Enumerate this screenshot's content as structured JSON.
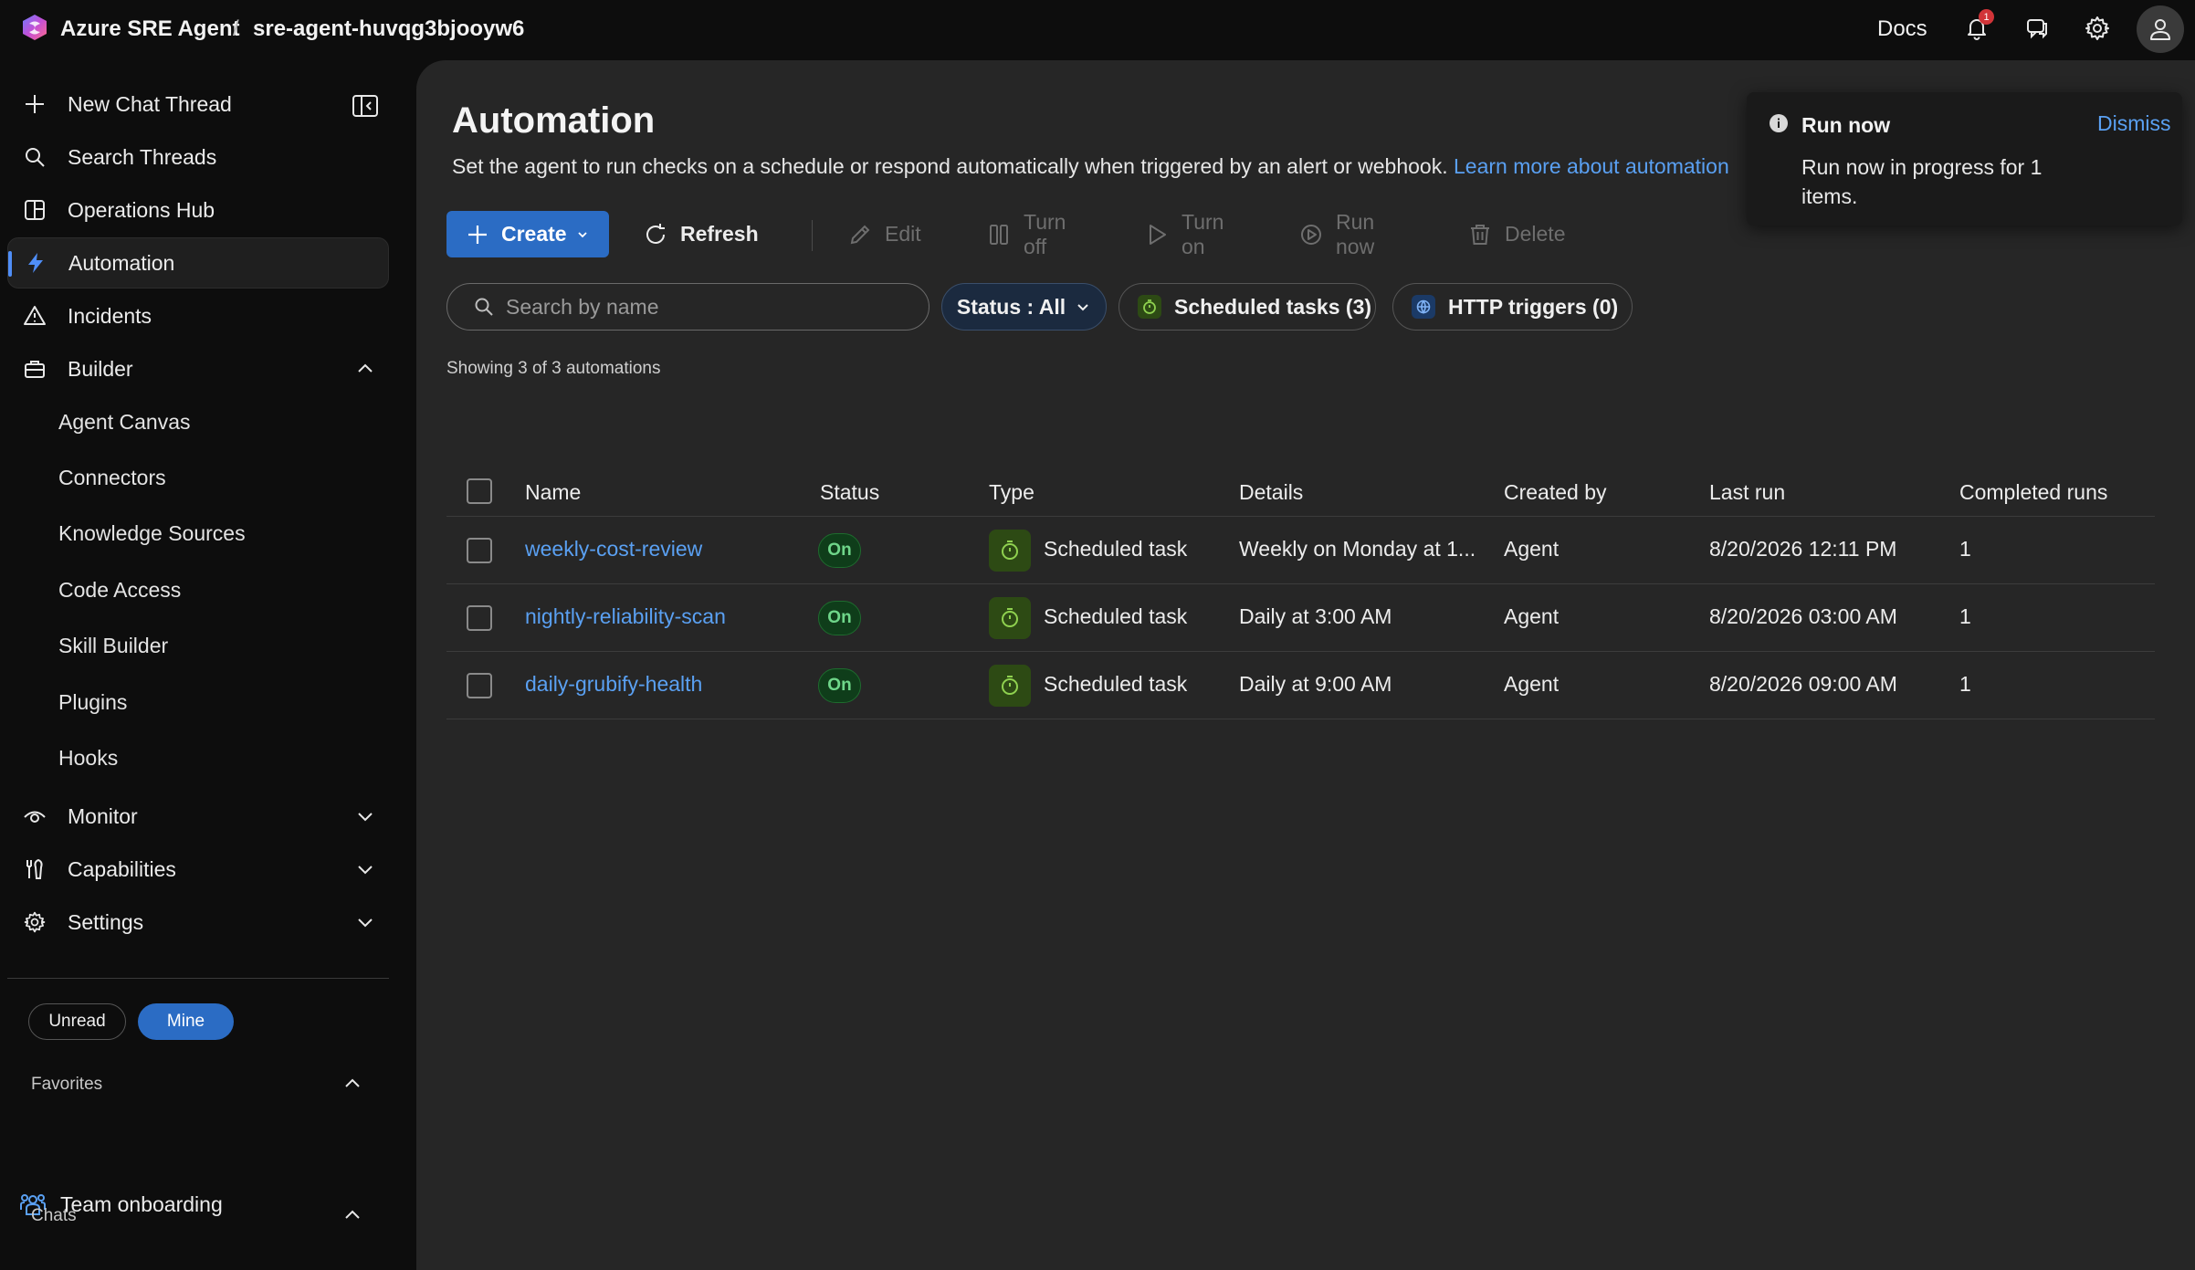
{
  "topbar": {
    "app_name": "Azure SRE Agent",
    "separator": "/",
    "agent_name": "sre-agent-huvqg3bjooyw6",
    "docs_label": "Docs",
    "notification_count": "1"
  },
  "sidebar": {
    "new_chat": "New Chat Thread",
    "search_threads": "Search Threads",
    "operations_hub": "Operations Hub",
    "automation": "Automation",
    "incidents": "Incidents",
    "builder": "Builder",
    "builder_items": [
      "Agent Canvas",
      "Connectors",
      "Knowledge Sources",
      "Code Access",
      "Skill Builder",
      "Plugins",
      "Hooks"
    ],
    "monitor": "Monitor",
    "capabilities": "Capabilities",
    "settings": "Settings",
    "filter_unread": "Unread",
    "filter_mine": "Mine",
    "favorites_label": "Favorites",
    "favorite_item": "Team onboarding",
    "chats_label": "Chats"
  },
  "main": {
    "title": "Automation",
    "description": "Set the agent to run checks on a schedule or respond automatically when triggered by an alert or webhook.",
    "learn_more": "Learn more about automation",
    "toolbar": {
      "create": "Create",
      "refresh": "Refresh",
      "edit": "Edit",
      "turn_off": "Turn off",
      "turn_on": "Turn on",
      "run_now": "Run now",
      "delete": "Delete"
    },
    "search_placeholder": "Search by name",
    "filters": {
      "status": "Status : All",
      "scheduled": "Scheduled tasks (3)",
      "http": "HTTP triggers (0)"
    },
    "showing": "Showing 3 of 3 automations",
    "columns": {
      "name": "Name",
      "status": "Status",
      "type": "Type",
      "details": "Details",
      "created_by": "Created by",
      "last_run": "Last run",
      "completed_runs": "Completed runs"
    },
    "rows": [
      {
        "name": "weekly-cost-review",
        "status": "On",
        "type": "Scheduled task",
        "details": "Weekly on Monday at 1...",
        "created_by": "Agent",
        "last_run": "8/20/2026 12:11 PM",
        "completed_runs": "1"
      },
      {
        "name": "nightly-reliability-scan",
        "status": "On",
        "type": "Scheduled task",
        "details": "Daily at 3:00 AM",
        "created_by": "Agent",
        "last_run": "8/20/2026 03:00 AM",
        "completed_runs": "1"
      },
      {
        "name": "daily-grubify-health",
        "status": "On",
        "type": "Scheduled task",
        "details": "Daily at 9:00 AM",
        "created_by": "Agent",
        "last_run": "8/20/2026 09:00 AM",
        "completed_runs": "1"
      }
    ]
  },
  "toast": {
    "title": "Run now",
    "dismiss": "Dismiss",
    "message": "Run now in progress for 1 items."
  },
  "colors": {
    "accent": "#2b6cc4",
    "link": "#5aa0f2",
    "status_on": "#6fd68a",
    "badge_red": "#d13438"
  }
}
